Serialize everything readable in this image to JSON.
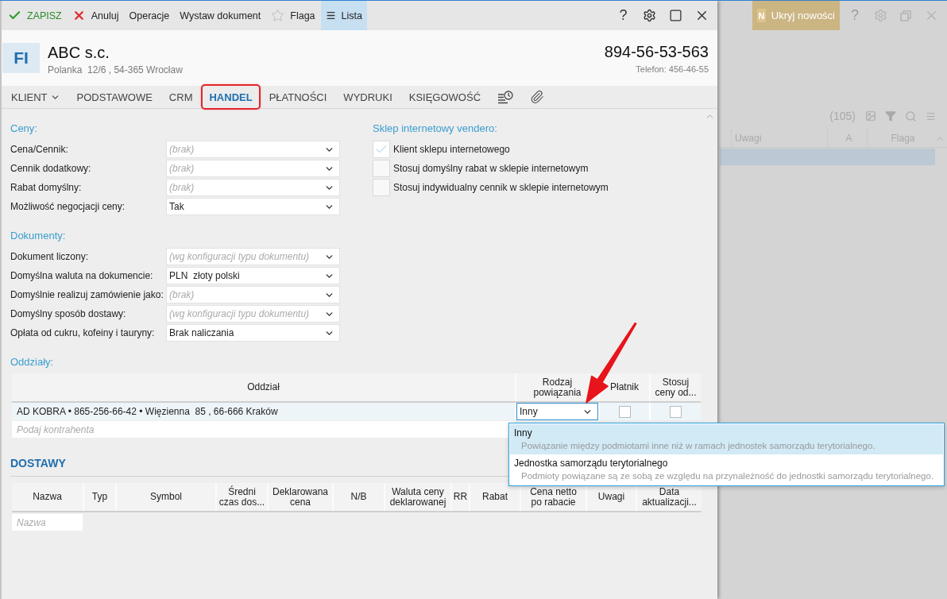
{
  "toolbar": {
    "items": [
      {
        "kind": "save",
        "label": "ZAPISZ",
        "active": false
      },
      {
        "kind": "cancel",
        "label": "Anuluj",
        "active": false
      },
      {
        "kind": "plain",
        "label": "Operacje",
        "active": false
      },
      {
        "kind": "plain",
        "label": "Wystaw dokument",
        "active": false
      },
      {
        "kind": "flag",
        "label": "Flaga",
        "active": false
      },
      {
        "kind": "list",
        "label": "Lista",
        "active": true
      }
    ],
    "help": "?"
  },
  "header": {
    "badge": "FI",
    "name": "ABC s.c.",
    "address": "Polanka  12/6 , 54-365 Wrocław",
    "tax_id": "894-56-53-563",
    "phone": "Telefon: 456-46-55"
  },
  "tabs": [
    {
      "kind": "menu",
      "label": "KLIENT",
      "selected": false,
      "outlined": false
    },
    {
      "kind": "text",
      "label": "PODSTAWOWE",
      "selected": false,
      "outlined": false
    },
    {
      "kind": "text",
      "label": "CRM",
      "selected": false,
      "outlined": false
    },
    {
      "kind": "text",
      "label": "HANDEL",
      "selected": true,
      "outlined": true
    },
    {
      "kind": "text",
      "label": "PŁATNOŚCI",
      "selected": false,
      "outlined": false
    },
    {
      "kind": "text",
      "label": "WYDRUKI",
      "selected": false,
      "outlined": false
    },
    {
      "kind": "text",
      "label": "KSIĘGOWOŚĆ",
      "selected": false,
      "outlined": false
    },
    {
      "kind": "history",
      "selected": false,
      "outlined": false
    },
    {
      "kind": "attachments",
      "selected": false,
      "outlined": false
    }
  ],
  "prices": {
    "title": "Ceny:",
    "fields": [
      {
        "label": "Cena/Cennik:",
        "placeholder": "(brak)"
      },
      {
        "label": "Cennik dodatkowy:",
        "placeholder": "(brak)"
      },
      {
        "label": "Rabat domyślny:",
        "placeholder": "(brak)"
      },
      {
        "label": "Możliwość negocjacji ceny:",
        "value": "Tak"
      }
    ]
  },
  "documents": {
    "title": "Dokumenty:",
    "fields": [
      {
        "label": "Dokument liczony:",
        "placeholder": "(wg konfiguracji typu dokumentu)"
      },
      {
        "label": "Domyślna waluta na dokumencie:",
        "value": "PLN  złoty polski"
      },
      {
        "label": "Domyślnie realizuj zamówienie jako:",
        "placeholder": "(brak)"
      },
      {
        "label": "Domyślny sposób dostawy:",
        "placeholder": "(wg konfiguracji typu dokumentu)"
      },
      {
        "label": "Opłata od cukru, kofeiny i tauryny:",
        "value": "Brak naliczania"
      }
    ]
  },
  "web_shop": {
    "title": "Sklep internetowy vendero:",
    "options": [
      {
        "label": "Klient sklepu internetowego",
        "checked": true
      },
      {
        "label": "Stosuj domyślny rabat w sklepie internetowym",
        "checked": false
      },
      {
        "label": "Stosuj indywidualny cennik w sklepie internetowym",
        "checked": false
      }
    ]
  },
  "branches": {
    "title": "Oddziały:",
    "columns": [
      "Oddział",
      "Rodzaj powiązania",
      "Płatnik",
      "Stosuj ceny od..."
    ],
    "rows": [
      {
        "branch": "AD KOBRA • 865-256-66-42 • Więzienna  85 , 66-666 Kraków",
        "relation": {
          "value": "Inny",
          "open": true,
          "options": [
            {
              "label": "Inny",
              "description": "Powiązanie między podmiotami inne niż w ramach jednostek samorządu terytorialnego.",
              "selected": true
            },
            {
              "label": "Jednostka samorządu terytorialnego",
              "description": "Podmioty powiązane są ze sobą ze względu na przynależność do jednostki samorządu terytorialnego.",
              "selected": false
            }
          ]
        },
        "payer": false,
        "use_prices": false
      }
    ],
    "new_row_placeholder": "Podaj kontrahenta"
  },
  "deliveries": {
    "title": "DOSTAWY",
    "columns": [
      "Nazwa",
      "Typ",
      "Symbol",
      "Średni czas dos...",
      "Deklarowana cena",
      "N/B",
      "Waluta ceny deklarowanej",
      "RR",
      "Rabat",
      "Cena netto po rabacie",
      "Uwagi",
      "Data aktualizacji..."
    ],
    "new_row_placeholder": "Nazwa"
  },
  "background_window": {
    "news_button": {
      "badge": "N",
      "label": "Ukryj nowości"
    },
    "help": "?",
    "count": "(105)",
    "columns": [
      "Uwagi",
      "A",
      "Flaga"
    ],
    "rows": [
      {
        "selected": true
      }
    ]
  }
}
